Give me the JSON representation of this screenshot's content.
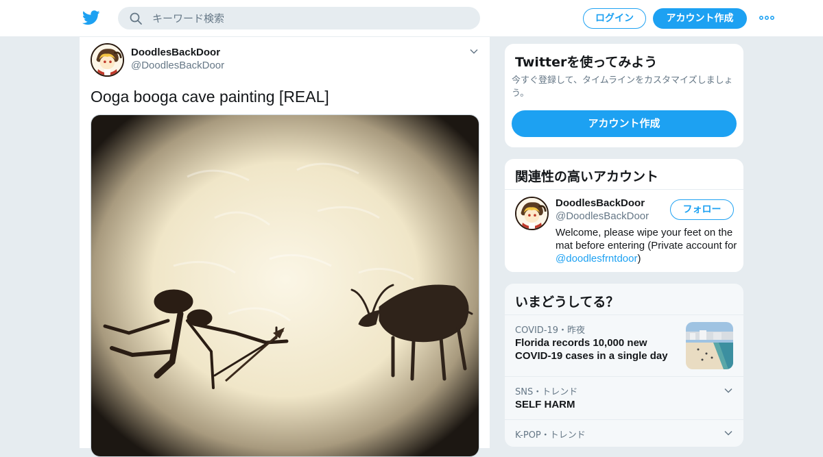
{
  "header": {
    "search_placeholder": "キーワード検索",
    "login_label": "ログイン",
    "signup_label": "アカウント作成",
    "brand_color": "#1da1f2"
  },
  "tweet": {
    "author_name": "DoodlesBackDoor",
    "author_handle": "@DoodlesBackDoor",
    "text": "Ooga booga cave painting [REAL]"
  },
  "sidebar": {
    "try_card": {
      "title": "Twitterを使ってみよう",
      "description": "今すぐ登録して、タイムラインをカスタマイズしましょう。",
      "cta_label": "アカウント作成"
    },
    "related": {
      "title": "関連性の高いアカウント",
      "account": {
        "name": "DoodlesBackDoor",
        "handle": "@DoodlesBackDoor",
        "follow_label": "フォロー",
        "bio_prefix": "Welcome, please wipe your feet on the mat before entering (Private account for ",
        "bio_mention": "@doodlesfrntdoor",
        "bio_suffix": ")"
      }
    },
    "trends": {
      "title": "いまどうしてる？",
      "items": [
        {
          "meta": "COVID-19・昨夜",
          "headline": "Florida records 10,000 new COVID-19 cases in a single day"
        },
        {
          "meta": "SNS・トレンド",
          "headline": "SELF HARM"
        },
        {
          "meta": "K-POP・トレンド",
          "headline": ""
        }
      ]
    }
  }
}
